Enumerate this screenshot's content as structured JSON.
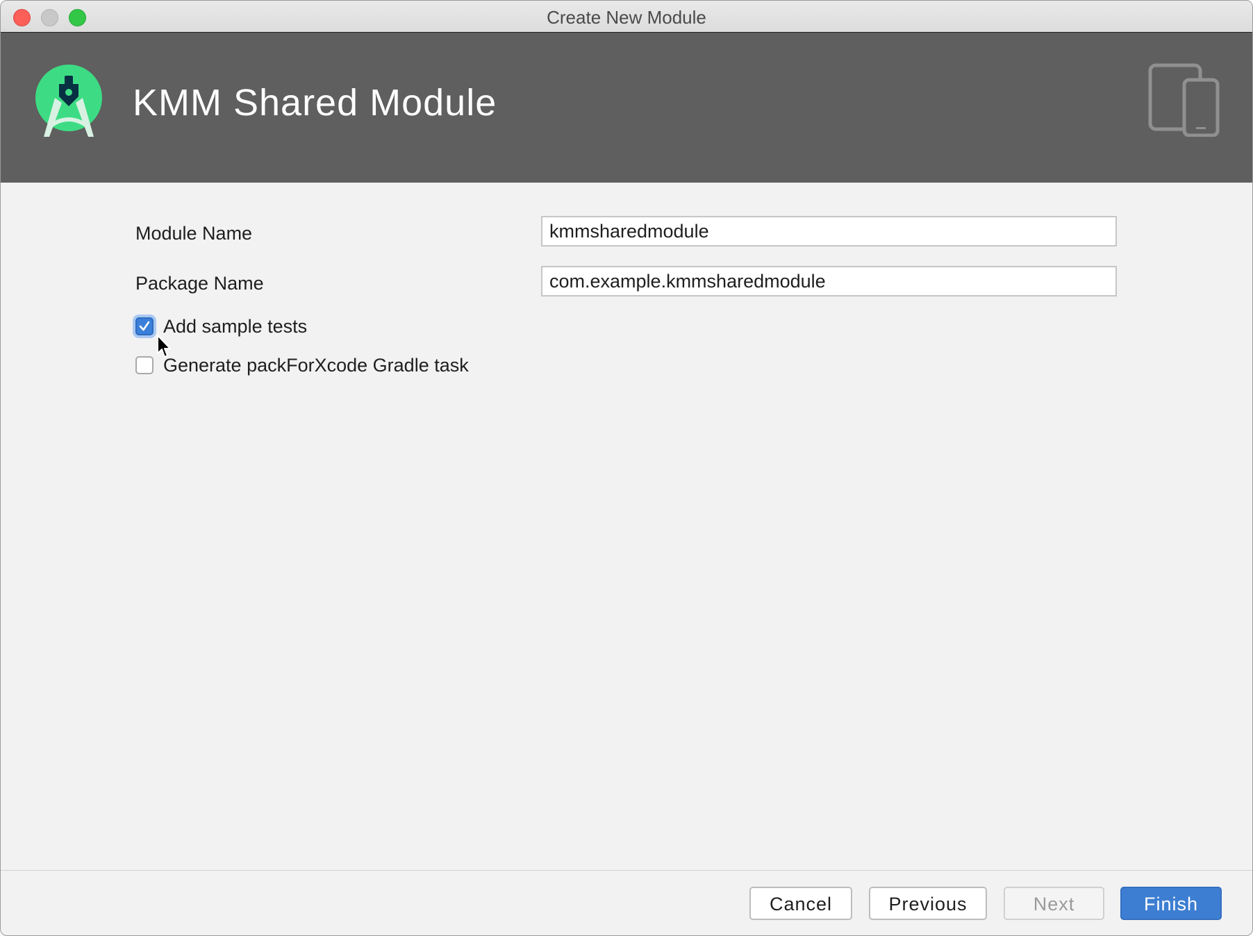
{
  "window": {
    "title": "Create New Module"
  },
  "header": {
    "title": "KMM Shared Module",
    "logo_icon": "android-studio-logo-icon",
    "device_icon": "tablet-phone-devices-icon",
    "background": "#5f5f5f"
  },
  "form": {
    "module_name": {
      "label": "Module Name",
      "value": "kmmsharedmodule"
    },
    "package_name": {
      "label": "Package Name",
      "value": "com.example.kmmsharedmodule"
    },
    "options": [
      {
        "label": "Add sample tests",
        "checked": true
      },
      {
        "label": "Generate packForXcode Gradle task",
        "checked": false
      }
    ]
  },
  "buttons": {
    "cancel": "Cancel",
    "previous": "Previous",
    "next": "Next",
    "finish": "Finish",
    "next_enabled": false
  },
  "colors": {
    "accent": "#3d7ed2",
    "checkbox_checked": "#3a7fd9",
    "logo_green": "#3ddc84"
  }
}
